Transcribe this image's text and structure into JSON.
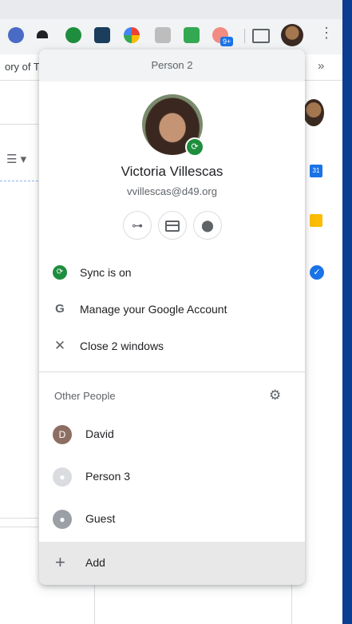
{
  "colors": {
    "sync_green": "#1e8e3e",
    "menu_header_bg": "#f1f3f4",
    "add_row_bg": "#e8e8e8",
    "side_bar_blue": "#0b3d91"
  },
  "browser": {
    "bookmark_text": "ory of T",
    "bookmark_more": "»",
    "extension_badge": "9+",
    "calendar_day": "31"
  },
  "menu": {
    "profile_label": "Person 2",
    "user_name": "Victoria Villescas",
    "user_email": "vvillescas@d49.org",
    "quick_buttons": [
      {
        "icon": "key-icon"
      },
      {
        "icon": "payment-card-icon"
      },
      {
        "icon": "location-pin-icon"
      }
    ],
    "sync_label": "Sync is on",
    "manage_label": "Manage your Google Account",
    "close_label": "Close 2 windows",
    "other_people_label": "Other People",
    "people": [
      {
        "initial": "D",
        "name": "David",
        "icon": "avatar-initial"
      },
      {
        "initial": "",
        "name": "Person 3",
        "icon": "person-silhouette-icon"
      },
      {
        "initial": "",
        "name": "Guest",
        "icon": "guest-icon"
      }
    ],
    "add_label": "Add"
  }
}
